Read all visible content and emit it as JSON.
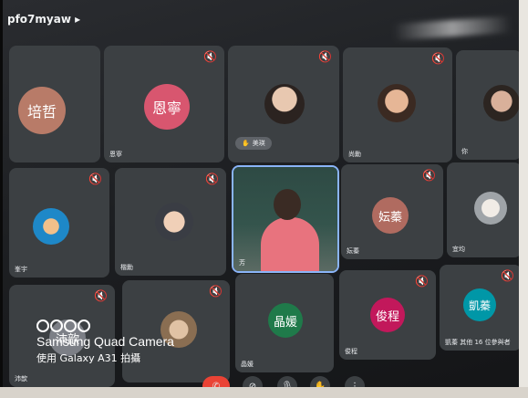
{
  "meeting_code": "pfo7myaw ▸",
  "participants": [
    {
      "id": "t1",
      "name": "",
      "avatar_text": "培哲",
      "avatar_color": "#b87b68"
    },
    {
      "id": "t2",
      "name": "恩寧",
      "avatar_text": "恩寧",
      "avatar_color": "#d8566f"
    },
    {
      "id": "t3",
      "name": "",
      "raise_label": "美瑛",
      "type": "photo"
    },
    {
      "id": "t4",
      "name": "尚勳",
      "type": "photo"
    },
    {
      "id": "t5",
      "name": "你",
      "type": "photo"
    },
    {
      "id": "t6",
      "name": "峯宇",
      "type": "photo"
    },
    {
      "id": "t7",
      "name": "楷勳",
      "type": "photo"
    },
    {
      "id": "t8",
      "name": "芳",
      "type": "video"
    },
    {
      "id": "t9",
      "name": "妘蓁",
      "avatar_text": "妘蓁",
      "avatar_color": "#b06b60"
    },
    {
      "id": "t10",
      "name": "宜均",
      "type": "photo"
    },
    {
      "id": "t11",
      "name": "沛歆",
      "avatar_text": "沛歆",
      "avatar_color": "#7c7f86"
    },
    {
      "id": "t12",
      "name": "",
      "type": "photo"
    },
    {
      "id": "t13",
      "name": "晶媛",
      "avatar_text": "晶媛",
      "avatar_color": "#1f7a4a"
    },
    {
      "id": "t14",
      "name": "俊程",
      "avatar_text": "俊程",
      "avatar_color": "#c2185b"
    },
    {
      "id": "t15",
      "name": "凱蓁",
      "avatar_text": "凱蓁",
      "avatar_color": "#0097a7",
      "extra": "其他 16 位參與者"
    }
  ],
  "camera_watermark": {
    "line1": "Samsung Quad Camera",
    "line2": "使用 Galaxy A31 拍攝"
  },
  "controls": {
    "end": "✆",
    "camera": "⊘",
    "mic": "🎙",
    "hand": "✋",
    "more": "⋮"
  },
  "icons": {
    "mute": "🔇"
  }
}
